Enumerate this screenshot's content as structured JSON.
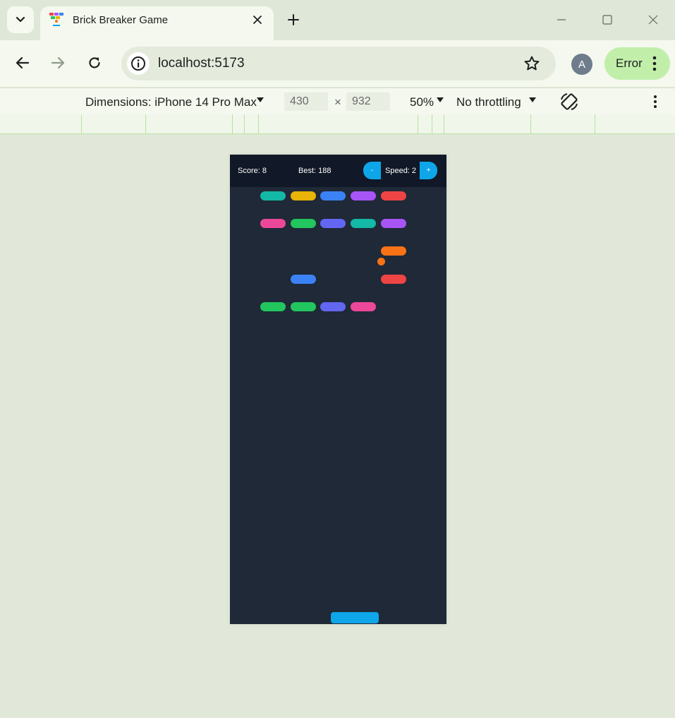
{
  "browser": {
    "tab": {
      "title": "Brick Breaker Game"
    },
    "address": {
      "url": "localhost:5173"
    },
    "profile_initial": "A",
    "status_label": "Error"
  },
  "devtools": {
    "device_label": "Dimensions: iPhone 14 Pro Max",
    "width_value": "430",
    "times": "×",
    "height_value": "932",
    "zoom": "50%",
    "throttling": "No throttling"
  },
  "game": {
    "score_text": "Score: 8",
    "best_text": "Best: 188",
    "speed_text": "Speed: 2",
    "decrease_label": "-",
    "increase_label": "+",
    "colors": {
      "background": "#1f2937",
      "hud": "#111827",
      "accent": "#0ea5e9",
      "teal": "#14b8a6",
      "yellow": "#eab308",
      "blue": "#3b82f6",
      "purple": "#a855f7",
      "red": "#ef4444",
      "pink": "#ec4899",
      "green": "#22c55e",
      "indigo": "#6366f1",
      "orange": "#f97316"
    },
    "bricks": [
      [
        "teal",
        "yellow",
        "blue",
        "purple",
        "red"
      ],
      [
        "pink",
        "green",
        "indigo",
        "teal",
        "purple"
      ],
      [
        null,
        null,
        null,
        null,
        "orange"
      ],
      [
        null,
        "blue",
        null,
        null,
        "red"
      ],
      [
        "green",
        "green",
        "indigo",
        "pink",
        null
      ]
    ],
    "ball_color": "orange",
    "paddle_color": "accent"
  }
}
